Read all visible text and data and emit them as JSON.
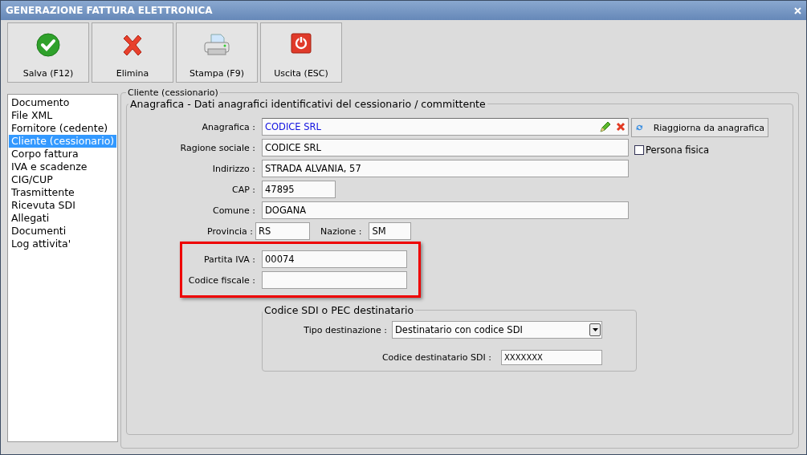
{
  "window": {
    "title": "GENERAZIONE FATTURA ELETTRONICA"
  },
  "toolbar": [
    {
      "label": "Salva (F12)",
      "kind": "check"
    },
    {
      "label": "Elimina",
      "kind": "cross"
    },
    {
      "label": "Stampa (F9)",
      "kind": "printer"
    },
    {
      "label": "Uscita (ESC)",
      "kind": "power"
    }
  ],
  "sidebar": {
    "items": [
      {
        "label": "Documento",
        "selected": false
      },
      {
        "label": "File XML",
        "selected": false
      },
      {
        "label": "Fornitore (cedente)",
        "selected": false
      },
      {
        "label": "Cliente (cessionario)",
        "selected": true
      },
      {
        "label": "Corpo fattura",
        "selected": false
      },
      {
        "label": "IVA e scadenze",
        "selected": false
      },
      {
        "label": "CIG/CUP",
        "selected": false
      },
      {
        "label": "Trasmittente",
        "selected": false
      },
      {
        "label": "Ricevuta SDI",
        "selected": false
      },
      {
        "label": "Allegati",
        "selected": false
      },
      {
        "label": "Documenti",
        "selected": false
      },
      {
        "label": "Log attivita'",
        "selected": false
      }
    ]
  },
  "client_group": {
    "title": "Cliente (cessionario)",
    "anagrafica_group": {
      "title": "Anagrafica - Dati anagrafici identificativi del cessionario / committente",
      "fields": [
        {
          "kind": "lookup",
          "label": "Anagrafica :",
          "value": "CODICE SRL"
        },
        {
          "kind": "wide",
          "label": "Ragione sociale :",
          "value": "CODICE SRL"
        },
        {
          "kind": "wide",
          "label": "Indirizzo :",
          "value": "STRADA ALVANIA, 57"
        },
        {
          "kind": "short",
          "label": "CAP :",
          "value": "47895"
        },
        {
          "kind": "wide",
          "label": "Comune :",
          "value": "DOGANA"
        },
        {
          "kind": "pair",
          "label": "Provincia :",
          "value": "RS",
          "label_2": "Nazione :",
          "value_2": "SM"
        }
      ],
      "highlighted_fields": [
        {
          "label": "Partita IVA :",
          "value": "00074"
        },
        {
          "label": "Codice fiscale :"
        }
      ],
      "refresh_button": "Riaggiorna da anagrafica",
      "persona_fisica": {
        "label": "Persona fisica",
        "checked": false
      }
    },
    "sdi_group": {
      "title": "Codice SDI o PEC destinatario",
      "tipo_destinazione": {
        "label": "Tipo destinazione :",
        "value": "Destinatario con codice SDI"
      },
      "codice_destinatario": {
        "label": "Codice destinatario SDI :",
        "value": "XXXXXXX"
      }
    }
  }
}
